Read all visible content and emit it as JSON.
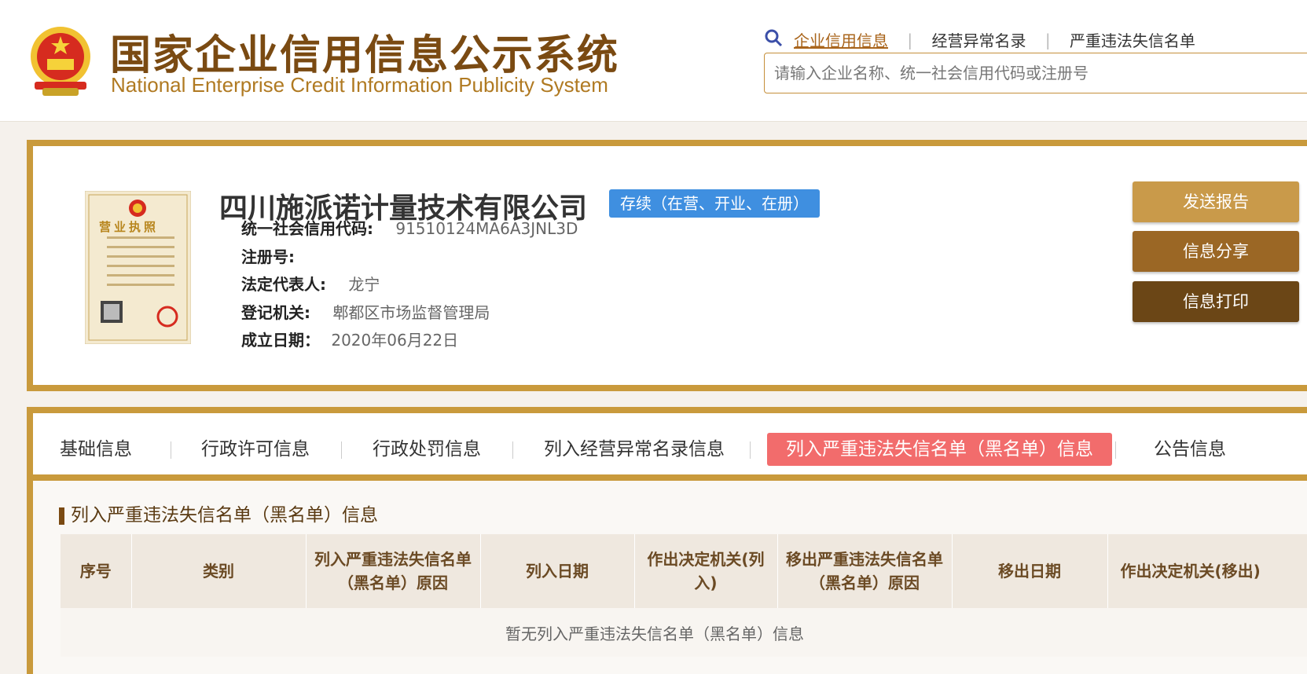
{
  "header": {
    "title_cn": "国家企业信用信息公示系统",
    "title_en": "National Enterprise Credit Information Publicity System",
    "links": [
      "企业信用信息",
      "经营异常名录",
      "严重违法失信名单"
    ],
    "search_placeholder": "请输入企业名称、统一社会信用代码或注册号"
  },
  "company": {
    "name": "四川施派诺计量技术有限公司",
    "status": "存续（在营、开业、在册）",
    "license_title": "营业执照",
    "fields": [
      {
        "label": "统一社会信用代码:",
        "value": "91510124MA6A3JNL3D"
      },
      {
        "label": "注册号:",
        "value": ""
      },
      {
        "label": "法定代表人:",
        "value": "龙宁"
      },
      {
        "label": "登记机关:",
        "value": "郫都区市场监督管理局"
      },
      {
        "label": "成立日期：",
        "value": "2020年06月22日"
      }
    ],
    "actions": [
      "发送报告",
      "信息分享",
      "信息打印"
    ]
  },
  "tabs": [
    "基础信息",
    "行政许可信息",
    "行政处罚信息",
    "列入经营异常名录信息",
    "列入严重违法失信名单（黑名单）信息",
    "公告信息"
  ],
  "section": {
    "title": "列入严重违法失信名单（黑名单）信息",
    "columns": [
      "序号",
      "类别",
      "列入严重违法失信名单（黑名单）原因",
      "列入日期",
      "作出决定机关(列入)",
      "移出严重违法失信名单（黑名单）原因",
      "移出日期",
      "作出决定机关(移出)"
    ],
    "empty_text": "暂无列入严重违法失信名单（黑名单）信息"
  },
  "colors": {
    "accent": "#c99a3c",
    "brand_dark": "#7a4a12",
    "status_blue": "#3f8fe0",
    "active_tab": "#f26c6c"
  }
}
